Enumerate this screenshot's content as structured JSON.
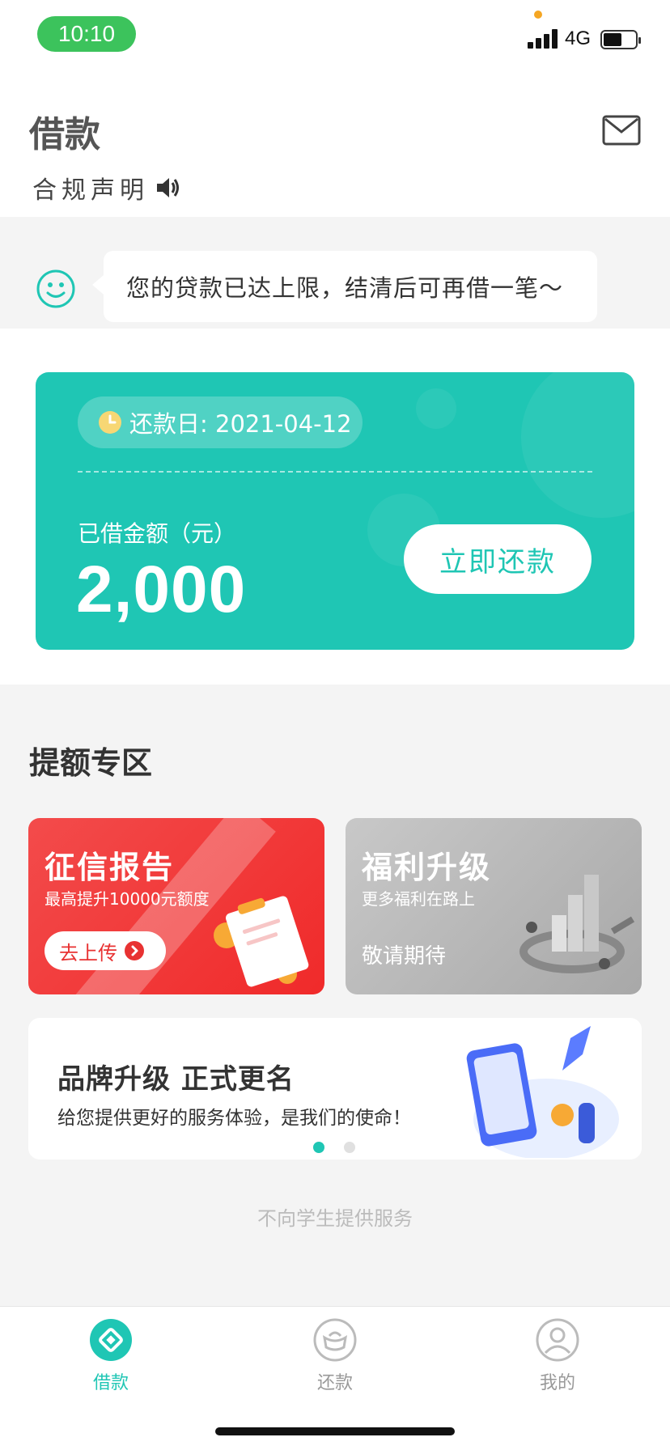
{
  "status_bar": {
    "time": "10:10",
    "network": "4G"
  },
  "header": {
    "title": "借款",
    "compliance_label": "合规声明"
  },
  "notice": {
    "message": "您的贷款已达上限，结清后可再借一笔～"
  },
  "loan_card": {
    "due_date_label": "还款日: 2021-04-12",
    "amount_label": "已借金额（元）",
    "amount": "2,000",
    "repay_button": "立即还款"
  },
  "boost_zone": {
    "title": "提额专区",
    "credit_report": {
      "title": "征信报告",
      "subtitle": "最高提升10000元额度",
      "button": "去上传"
    },
    "benefits": {
      "title": "福利升级",
      "subtitle": "更多福利在路上",
      "note": "敬请期待"
    },
    "brand_banner": {
      "title": "品牌升级 正式更名",
      "subtitle": "给您提供更好的服务体验，是我们的使命！"
    },
    "footer_note": "不向学生提供服务"
  },
  "tab_bar": {
    "items": [
      {
        "label": "借款",
        "icon": "borrow-icon",
        "active": true
      },
      {
        "label": "还款",
        "icon": "repay-icon",
        "active": false
      },
      {
        "label": "我的",
        "icon": "profile-icon",
        "active": false
      }
    ]
  },
  "colors": {
    "accent": "#1fc6b4",
    "status_pill": "#3cc35c",
    "promo_red": "#f02a2a"
  }
}
